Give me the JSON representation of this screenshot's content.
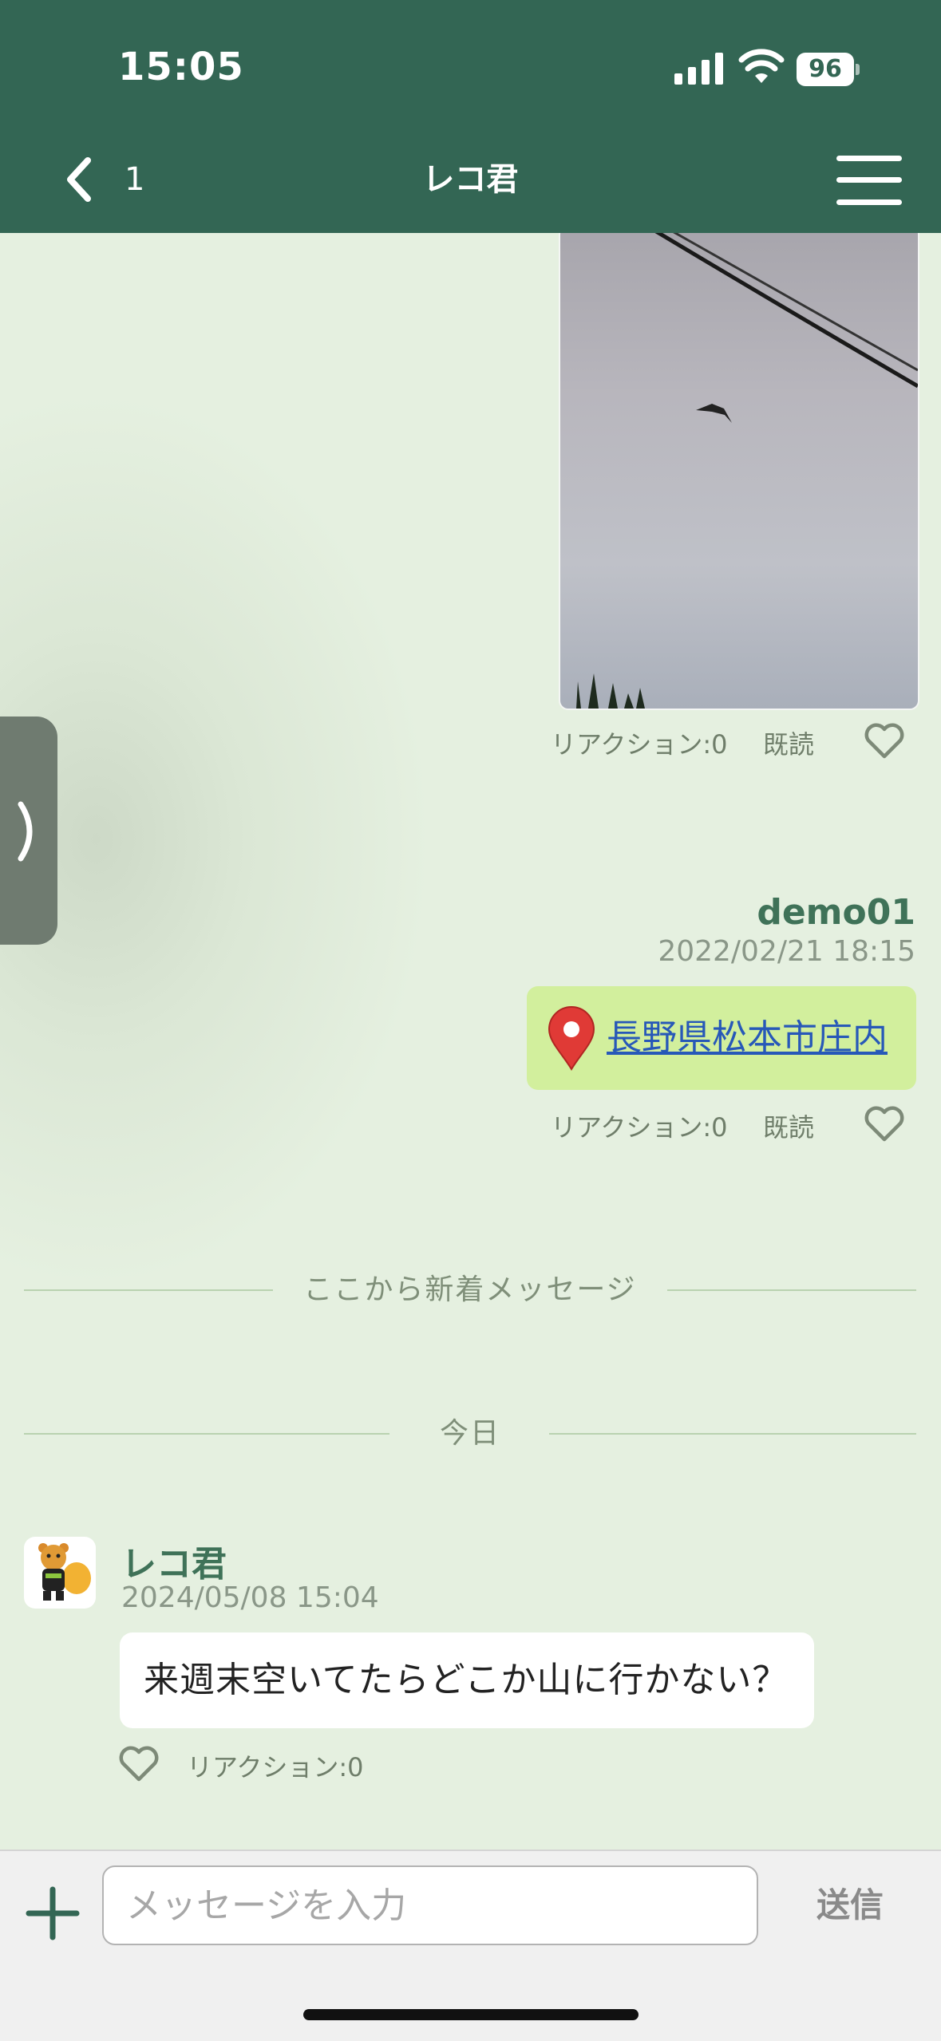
{
  "status_bar": {
    "time": "15:05",
    "battery": "96"
  },
  "header": {
    "back_count": "1",
    "title": "レコ君"
  },
  "messages": [
    {
      "type": "image",
      "reaction": "リアクション:0",
      "read": "既読"
    },
    {
      "type": "location",
      "sender": "demo01",
      "time": "2022/02/21 18:15",
      "text": "長野県松本市庄内",
      "reaction": "リアクション:0",
      "read": "既読"
    }
  ],
  "dividers": {
    "new_messages": "ここから新着メッセージ",
    "today": "今日"
  },
  "incoming": {
    "sender": "レコ君",
    "time": "2024/05/08 15:04",
    "text": "来週末空いてたらどこか山に行かない？",
    "reaction": "リアクション:0"
  },
  "composer": {
    "placeholder": "メッセージを入力",
    "send_label": "送信"
  },
  "colors": {
    "header": "#336654",
    "chat_bg": "#e5f0e0",
    "own_bubble": "#d2ef9d",
    "link": "#2758b8",
    "name": "#3f7258"
  },
  "icons": [
    "back-chevron-icon",
    "menu-icon",
    "heart-icon",
    "map-pin-icon",
    "plus-icon",
    "signal-icon",
    "wifi-icon",
    "battery-icon",
    "side-tab-chevron-icon"
  ]
}
